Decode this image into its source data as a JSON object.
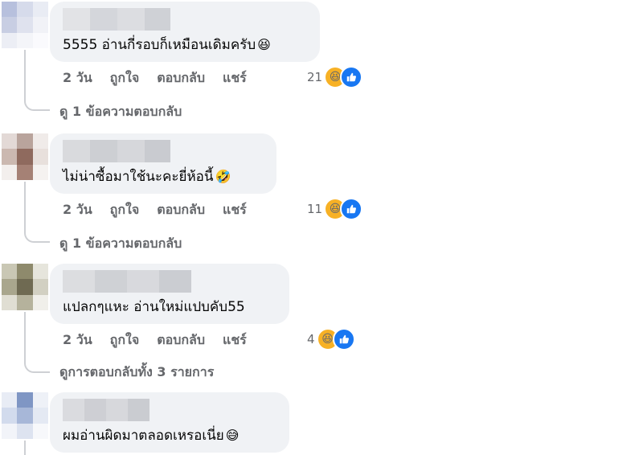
{
  "comments": [
    {
      "text": "5555 อ่านกี่รอบก็เหมือนเดิมครับ",
      "emoji": "😆",
      "time": "2 วัน",
      "like": "ถูกใจ",
      "reply": "ตอบกลับ",
      "share": "แชร์",
      "reaction_count": "21",
      "reaction_emoji": "😆",
      "replies_link": "ดู 1 ข้อความตอบกลับ"
    },
    {
      "text": "ไม่น่าซื้อมาใช้นะคะยี่ห้อนี้",
      "emoji": "🤣",
      "time": "2 วัน",
      "like": "ถูกใจ",
      "reply": "ตอบกลับ",
      "share": "แชร์",
      "reaction_count": "11",
      "reaction_emoji": "😆",
      "replies_link": "ดู 1 ข้อความตอบกลับ"
    },
    {
      "text": "แปลกๆแหะ อ่านใหม่แปบคับ55",
      "emoji": "",
      "time": "2 วัน",
      "like": "ถูกใจ",
      "reply": "ตอบกลับ",
      "share": "แชร์",
      "reaction_count": "4",
      "reaction_emoji": "😆",
      "replies_link": "ดูการตอบกลับทั้ง 3 รายการ"
    },
    {
      "text": "ผมอ่านผิดมาตลอดเหรอเนี่ย",
      "emoji": "😅"
    }
  ],
  "colors": {
    "bubble": "#f0f2f5",
    "meta_text": "#65676b",
    "like_blue": "#1877f2",
    "haha_yellow": "#f7b125",
    "thread_line": "#ced0d4"
  },
  "icons": [
    "haha-reaction-icon",
    "like-reaction-icon"
  ]
}
